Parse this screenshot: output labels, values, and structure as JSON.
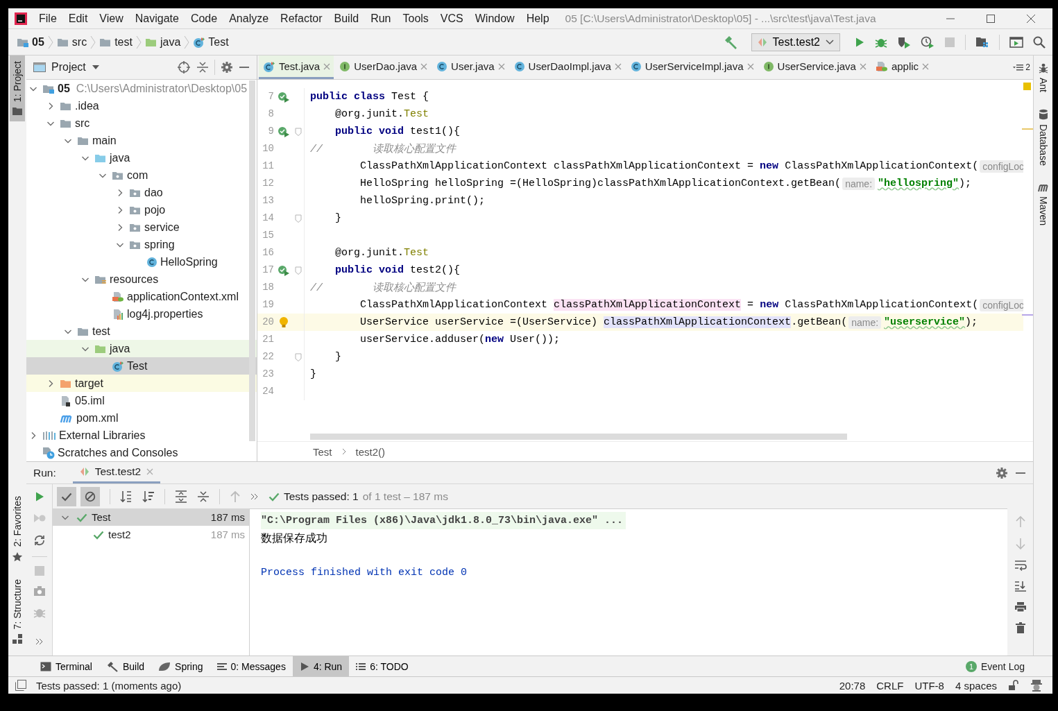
{
  "menu_bar": {
    "items": [
      "File",
      "Edit",
      "View",
      "Navigate",
      "Code",
      "Analyze",
      "Refactor",
      "Build",
      "Run",
      "Tools",
      "VCS",
      "Window",
      "Help"
    ],
    "title": "05 [C:\\Users\\Administrator\\Desktop\\05] - ...\\src\\test\\java\\Test.java"
  },
  "navigation_bar": {
    "breadcrumbs": [
      {
        "kind": "module",
        "label": "05"
      },
      {
        "kind": "folder",
        "label": "src"
      },
      {
        "kind": "folder",
        "label": "test"
      },
      {
        "kind": "test-folder",
        "label": "java"
      },
      {
        "kind": "test-class",
        "label": "Test"
      }
    ],
    "run_configuration": "Test.test2"
  },
  "left_stripe": {
    "top": [
      {
        "label": "1: Project",
        "kind": "project",
        "selected": true
      }
    ],
    "bottom": [
      {
        "label": "2: Favorites",
        "kind": "favorites",
        "selected": false
      },
      {
        "label": "7: Structure",
        "kind": "structure",
        "selected": false
      }
    ]
  },
  "right_stripe": [
    {
      "label": "Ant",
      "kind": "ant"
    },
    {
      "label": "Database",
      "kind": "database"
    },
    {
      "label": "Maven",
      "kind": "maven"
    }
  ],
  "project_panel": {
    "title": "Project",
    "tree": [
      {
        "label": "05",
        "kind": "module",
        "path": "C:\\Users\\Administrator\\Desktop\\05",
        "expanded": true,
        "selected": false,
        "children": [
          {
            "label": ".idea",
            "kind": "folder",
            "expanded": false,
            "selected": false
          },
          {
            "label": "src",
            "kind": "folder",
            "expanded": true,
            "selected": false,
            "children": [
              {
                "label": "main",
                "kind": "folder",
                "expanded": true,
                "selected": false,
                "children": [
                  {
                    "label": "java",
                    "kind": "source-folder",
                    "expanded": true,
                    "selected": false,
                    "children": [
                      {
                        "label": "com",
                        "kind": "package",
                        "expanded": true,
                        "selected": false,
                        "children": [
                          {
                            "label": "dao",
                            "kind": "package",
                            "expanded": false,
                            "selected": false
                          },
                          {
                            "label": "pojo",
                            "kind": "package",
                            "expanded": false,
                            "selected": false
                          },
                          {
                            "label": "service",
                            "kind": "package",
                            "expanded": false,
                            "selected": false
                          },
                          {
                            "label": "spring",
                            "kind": "package",
                            "expanded": true,
                            "selected": false,
                            "children": [
                              {
                                "label": "HelloSpring",
                                "kind": "class",
                                "selected": false
                              }
                            ]
                          }
                        ]
                      }
                    ]
                  },
                  {
                    "label": "resources",
                    "kind": "resources-folder",
                    "expanded": true,
                    "selected": false,
                    "children": [
                      {
                        "label": "applicationContext.xml",
                        "kind": "spring-xml",
                        "selected": false
                      },
                      {
                        "label": "log4j.properties",
                        "kind": "properties",
                        "selected": false
                      }
                    ]
                  }
                ]
              },
              {
                "label": "test",
                "kind": "folder",
                "expanded": true,
                "selected": false,
                "children": [
                  {
                    "label": "java",
                    "kind": "test-folder",
                    "expanded": true,
                    "selected": false,
                    "children": [
                      {
                        "label": "Test",
                        "kind": "test-class",
                        "selected": true
                      }
                    ]
                  }
                ]
              }
            ]
          },
          {
            "label": "target",
            "kind": "excluded-folder",
            "expanded": false,
            "selected": false
          },
          {
            "label": "05.iml",
            "kind": "iml",
            "selected": false
          },
          {
            "label": "pom.xml",
            "kind": "maven",
            "selected": false
          }
        ]
      },
      {
        "label": "External Libraries",
        "kind": "libraries",
        "expanded": false,
        "selected": false
      },
      {
        "label": "Scratches and Consoles",
        "kind": "scratches",
        "selected": false
      }
    ]
  },
  "editor": {
    "tabs": [
      {
        "label": "Test.java",
        "kind": "test-class",
        "selected": true
      },
      {
        "label": "UserDao.java",
        "kind": "interface",
        "selected": false
      },
      {
        "label": "User.java",
        "kind": "class",
        "selected": false
      },
      {
        "label": "UserDaoImpl.java",
        "kind": "class",
        "selected": false
      },
      {
        "label": "UserServiceImpl.java",
        "kind": "class",
        "selected": false
      },
      {
        "label": "UserService.java",
        "kind": "interface",
        "selected": false
      },
      {
        "label": "applic",
        "kind": "spring-xml",
        "selected": false
      }
    ],
    "hidden_tab_count": "2",
    "lines": [
      {
        "number": "7",
        "runnable": true,
        "intention_bulb": false,
        "fold": false,
        "current": false,
        "tokens": [
          {
            "kind": "keyword",
            "text": "public class"
          },
          {
            "kind": "plain",
            "text": " Test {"
          }
        ]
      },
      {
        "number": "8",
        "runnable": false,
        "intention_bulb": false,
        "fold": false,
        "current": false,
        "tokens": [
          {
            "kind": "plain",
            "text": "    @org.junit."
          },
          {
            "kind": "annotation",
            "text": "Test"
          }
        ]
      },
      {
        "number": "9",
        "runnable": true,
        "intention_bulb": false,
        "fold": true,
        "current": false,
        "tokens": [
          {
            "kind": "keyword",
            "text": "    public void"
          },
          {
            "kind": "plain",
            "text": " test1(){"
          }
        ]
      },
      {
        "number": "10",
        "runnable": false,
        "intention_bulb": false,
        "fold": false,
        "current": false,
        "tokens": [
          {
            "kind": "comment",
            "text": "//        读取核心配置文件"
          }
        ]
      },
      {
        "number": "11",
        "runnable": false,
        "intention_bulb": false,
        "fold": false,
        "current": false,
        "tokens": [
          {
            "kind": "plain",
            "text": "        ClassPathXmlApplicationContext classPathXmlApplicationContext = "
          },
          {
            "kind": "keyword",
            "text": "new"
          },
          {
            "kind": "plain",
            "text": " ClassPathXmlApplicationContext("
          },
          {
            "kind": "hint",
            "text": "configLoc"
          }
        ]
      },
      {
        "number": "12",
        "runnable": false,
        "intention_bulb": false,
        "fold": false,
        "current": false,
        "tokens": [
          {
            "kind": "plain",
            "text": "        HelloSpring helloSpring =(HelloSpring)classPathXmlApplicationContext.getBean("
          },
          {
            "kind": "hint",
            "text": "name:"
          },
          {
            "kind": "string",
            "text": "\"hellospring\""
          },
          {
            "kind": "plain",
            "text": ");"
          }
        ]
      },
      {
        "number": "13",
        "runnable": false,
        "intention_bulb": false,
        "fold": false,
        "current": false,
        "tokens": [
          {
            "kind": "plain",
            "text": "        helloSpring.print();"
          }
        ]
      },
      {
        "number": "14",
        "runnable": false,
        "intention_bulb": false,
        "fold": true,
        "current": false,
        "tokens": [
          {
            "kind": "plain",
            "text": "    }"
          }
        ]
      },
      {
        "number": "15",
        "runnable": false,
        "intention_bulb": false,
        "fold": false,
        "current": false
      },
      {
        "number": "16",
        "runnable": false,
        "intention_bulb": false,
        "fold": false,
        "current": false,
        "tokens": [
          {
            "kind": "plain",
            "text": "    @org.junit."
          },
          {
            "kind": "annotation",
            "text": "Test"
          }
        ]
      },
      {
        "number": "17",
        "runnable": true,
        "intention_bulb": false,
        "fold": true,
        "current": false,
        "tokens": [
          {
            "kind": "keyword",
            "text": "    public void"
          },
          {
            "kind": "plain",
            "text": " test2(){"
          }
        ]
      },
      {
        "number": "18",
        "runnable": false,
        "intention_bulb": false,
        "fold": false,
        "current": false,
        "tokens": [
          {
            "kind": "comment",
            "text": "//        读取核心配置文件"
          }
        ]
      },
      {
        "number": "19",
        "runnable": false,
        "intention_bulb": false,
        "fold": false,
        "current": false,
        "tokens": [
          {
            "kind": "plain",
            "text": "        ClassPathXmlApplicationContext "
          },
          {
            "kind": "write-usage",
            "text": "classPathXmlApplicationContext"
          },
          {
            "kind": "plain",
            "text": " = "
          },
          {
            "kind": "keyword",
            "text": "new"
          },
          {
            "kind": "plain",
            "text": " ClassPathXmlApplicationContext("
          },
          {
            "kind": "hint",
            "text": "configLoc"
          }
        ]
      },
      {
        "number": "20",
        "runnable": false,
        "intention_bulb": true,
        "fold": false,
        "current": true,
        "tokens": [
          {
            "kind": "plain",
            "text": "        UserService userService =(UserService) "
          },
          {
            "kind": "read-usage",
            "text": "classPathXmlApplicationContext"
          },
          {
            "kind": "plain",
            "text": ".getBean("
          },
          {
            "kind": "hint",
            "text": "name:"
          },
          {
            "kind": "string",
            "text": "\"userservice\""
          },
          {
            "kind": "plain",
            "text": ");"
          }
        ]
      },
      {
        "number": "21",
        "runnable": false,
        "intention_bulb": false,
        "fold": false,
        "current": false,
        "tokens": [
          {
            "kind": "plain",
            "text": "        userService.adduser("
          },
          {
            "kind": "keyword",
            "text": "new"
          },
          {
            "kind": "plain",
            "text": " User());"
          }
        ]
      },
      {
        "number": "22",
        "runnable": false,
        "intention_bulb": false,
        "fold": true,
        "current": false,
        "tokens": [
          {
            "kind": "plain",
            "text": "    }"
          }
        ]
      },
      {
        "number": "23",
        "runnable": false,
        "intention_bulb": false,
        "fold": false,
        "current": false,
        "tokens": [
          {
            "kind": "plain",
            "text": "}"
          }
        ]
      },
      {
        "number": "24",
        "runnable": false,
        "intention_bulb": false,
        "fold": false,
        "current": false
      }
    ],
    "breadcrumbs": [
      "Test",
      "test2()"
    ]
  },
  "run_panel": {
    "label": "Run:",
    "tab": "Test.test2",
    "filters": [
      {
        "kind": "show-passed",
        "selected": true
      },
      {
        "kind": "show-ignored",
        "selected": true
      }
    ],
    "status": {
      "result": "Tests passed: 1",
      "detail": "of 1 test – 187 ms"
    },
    "tests": [
      {
        "label": "Test",
        "time": "187 ms",
        "selected": true,
        "expanded": true,
        "children": [
          {
            "label": "test2",
            "time": "187 ms",
            "selected": false
          }
        ]
      }
    ],
    "console": [
      {
        "kind": "command",
        "text": "\"C:\\Program Files (x86)\\Java\\jdk1.8.0_73\\bin\\java.exe\" ..."
      },
      {
        "kind": "output",
        "text": "数据保存成功"
      },
      {
        "kind": "system",
        "text": "Process finished with exit code 0"
      }
    ]
  },
  "tool_tabs": [
    {
      "label": "Terminal",
      "kind": "terminal",
      "selected": false
    },
    {
      "label": "Build",
      "kind": "build",
      "selected": false
    },
    {
      "label": "Spring",
      "kind": "spring",
      "selected": false
    },
    {
      "label": "0: Messages",
      "kind": "messages",
      "selected": false
    },
    {
      "label": "4: Run",
      "kind": "run",
      "selected": true
    },
    {
      "label": "6: TODO",
      "kind": "todo",
      "selected": false
    }
  ],
  "event_log": {
    "label": "Event Log",
    "count": "1"
  },
  "status_bar": {
    "message": "Tests passed: 1 (moments ago)",
    "items": [
      "20:78",
      "CRLF",
      "UTF-8",
      "4 spaces"
    ]
  }
}
